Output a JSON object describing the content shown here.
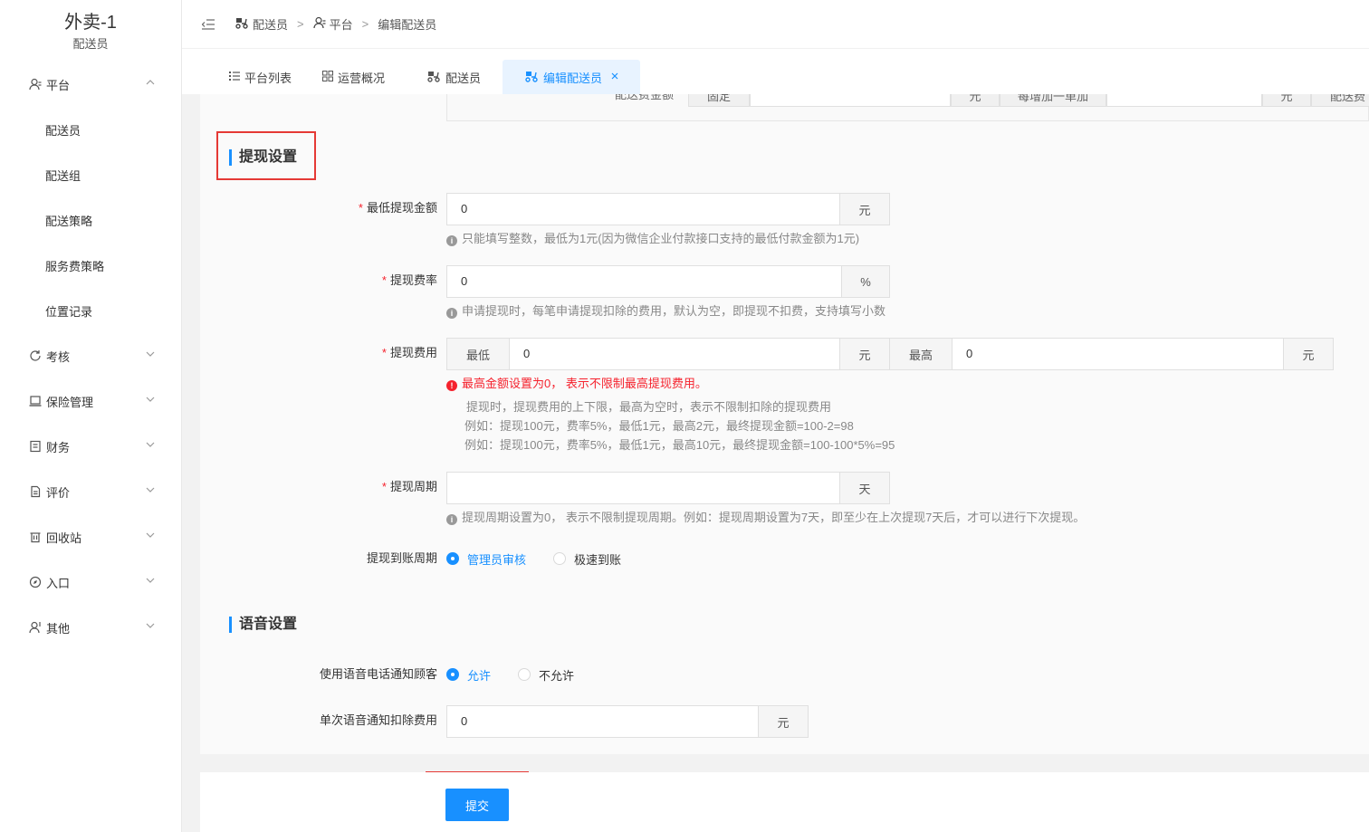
{
  "brand": {
    "title": "外卖-1",
    "subtitle": "配送员"
  },
  "sidebar": {
    "groups": [
      {
        "label": "平台",
        "expanded": true,
        "children": [
          "配送员",
          "配送组",
          "配送策略",
          "服务费策略",
          "位置记录"
        ]
      },
      {
        "label": "考核"
      },
      {
        "label": "保险管理"
      },
      {
        "label": "财务"
      },
      {
        "label": "评价"
      },
      {
        "label": "回收站"
      },
      {
        "label": "入口"
      },
      {
        "label": "其他"
      }
    ]
  },
  "breadcrumb": [
    "配送员",
    "平台",
    "编辑配送员"
  ],
  "tabs": [
    "平台列表",
    "运营概况",
    "配送员",
    "编辑配送员"
  ],
  "prev_row": {
    "label": "配送费金额",
    "fixed": "固定",
    "unit1": "元",
    "each_add": "每增加一单加",
    "unit2": "元",
    "tail": "配送费"
  },
  "withdraw": {
    "title": "提现设置",
    "min_amount": {
      "label": "最低提现金额",
      "value": "0",
      "unit": "元",
      "hint": "只能填写整数，最低为1元(因为微信企业付款接口支持的最低付款金额为1元)"
    },
    "rate": {
      "label": "提现费率",
      "value": "0",
      "unit": "%",
      "hint": "申请提现时，每笔申请提现扣除的费用，默认为空，即提现不扣费，支持填写小数"
    },
    "fee": {
      "label": "提现费用",
      "min_label": "最低",
      "min_value": "0",
      "min_unit": "元",
      "max_label": "最高",
      "max_value": "0",
      "max_unit": "元",
      "error": "最高金额设置为0， 表示不限制最高提现费用。",
      "lines": [
        "提现时，提现费用的上下限，最高为空时，表示不限制扣除的提现费用",
        "例如：提现100元，费率5%，最低1元，最高2元，最终提现金额=100-2=98",
        "例如：提现100元，费率5%，最低1元，最高10元，最终提现金额=100-100*5%=95"
      ]
    },
    "period": {
      "label": "提现周期",
      "value": "",
      "unit": "天",
      "hint": "提现周期设置为0， 表示不限制提现周期。例如：提现周期设置为7天，即至少在上次提现7天后，才可以进行下次提现。"
    },
    "arrival": {
      "label": "提现到账周期",
      "options": [
        "管理员审核",
        "极速到账"
      ],
      "selected": "管理员审核"
    }
  },
  "voice": {
    "title": "语音设置",
    "notify": {
      "label": "使用语音电话通知顾客",
      "options": [
        "允许",
        "不允许"
      ],
      "selected": "允许"
    },
    "fee": {
      "label": "单次语音通知扣除费用",
      "value": "0",
      "unit": "元"
    }
  },
  "submit_label": "提交",
  "colors": {
    "primary": "#1890ff",
    "danger": "#f5222d",
    "highlight": "#e53935"
  }
}
